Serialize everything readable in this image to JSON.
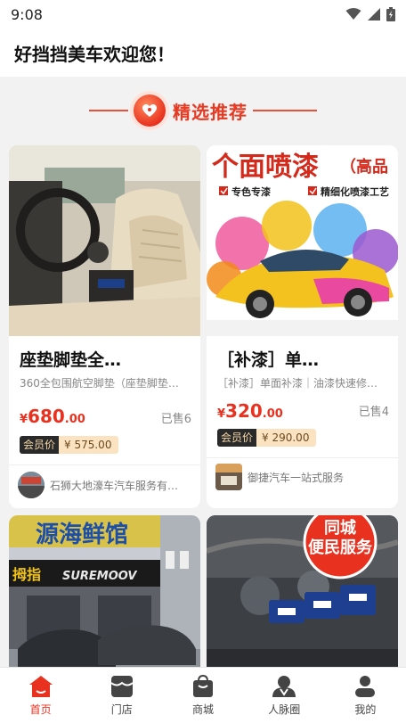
{
  "status": {
    "time": "9:08"
  },
  "header": {
    "title": "好挡挡美车欢迎您！"
  },
  "section": {
    "heading": "精选推荐"
  },
  "products": [
    {
      "name": "座垫脚垫全…",
      "desc": "360全包围航空脚垫（座垫脚垫…",
      "price_currency": "¥",
      "price_int": "680",
      "price_dec": ".00",
      "sold": "已售6",
      "member_tag": "会员价",
      "member_price": "¥ 575.00",
      "shop": "石狮大地濠车汽车服务有…"
    },
    {
      "name": "［补漆］单…",
      "desc": "［补漆］单面补漆｜油漆快速修…",
      "price_currency": "¥",
      "price_int": "320",
      "price_dec": ".00",
      "sold": "已售4",
      "member_tag": "会员价",
      "member_price": "¥ 290.00",
      "shop": "御捷汽车一站式服务",
      "ad_title": "个面喷漆",
      "ad_sub": "（高品",
      "ad_check1": "专色专漆",
      "ad_check2": "精细化喷漆工艺"
    },
    {
      "sign_text": "源海鲜馆",
      "sign_left": "拇指",
      "sign_brand": "SUREMOOV"
    },
    {
      "stamp_line1": "同城",
      "stamp_line2": "便民服务"
    }
  ],
  "tabs": [
    {
      "label": "首页",
      "icon": "home-icon",
      "active": true
    },
    {
      "label": "门店",
      "icon": "store-icon",
      "active": false
    },
    {
      "label": "商城",
      "icon": "shopping-bag-icon",
      "active": false
    },
    {
      "label": "人脉圈",
      "icon": "people-icon",
      "active": false
    },
    {
      "label": "我的",
      "icon": "profile-icon",
      "active": false
    }
  ],
  "colors": {
    "accent": "#e8321f",
    "member_bg": "#fbe3c2",
    "background": "#f2f2f2"
  }
}
